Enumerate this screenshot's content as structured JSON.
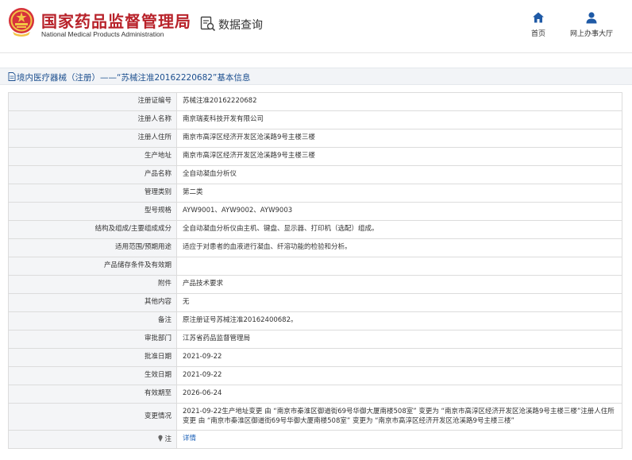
{
  "header": {
    "title": "国家药品监督管理局",
    "subtitle": "National Medical Products Administration",
    "query_label": "数据查询",
    "nav": {
      "home": "首页",
      "hall": "网上办事大厅"
    }
  },
  "breadcrumb": {
    "text": "境内医疗器械（注册）——“苏械注准20162220682”基本信息"
  },
  "record": {
    "rows": [
      {
        "label": "注册证编号",
        "value": "苏械注准20162220682"
      },
      {
        "label": "注册人名称",
        "value": "南京瑞麦科技开发有限公司"
      },
      {
        "label": "注册人住所",
        "value": "南京市高淳区经济开发区沧溪路9号主楼三楼"
      },
      {
        "label": "生产地址",
        "value": "南京市高淳区经济开发区沧溪路9号主楼三楼"
      },
      {
        "label": "产品名称",
        "value": "全自动凝血分析仪"
      },
      {
        "label": "管理类别",
        "value": "第二类"
      },
      {
        "label": "型号规格",
        "value": "AYW9001、AYW9002、AYW9003"
      },
      {
        "label": "结构及组成/主要组成成分",
        "value": "全自动凝血分析仪由主机、键盘、显示器、打印机（选配）组成。"
      },
      {
        "label": "适用范围/预期用途",
        "value": "适应于对患者的血液进行凝血、纤溶功能的检验和分析。"
      },
      {
        "label": "产品储存条件及有效期",
        "value": ""
      },
      {
        "label": "附件",
        "value": "产品技术要求"
      },
      {
        "label": "其他内容",
        "value": "无"
      },
      {
        "label": "备注",
        "value": "原注册证号苏械注准20162400682。"
      },
      {
        "label": "审批部门",
        "value": "江苏省药品监督管理局"
      },
      {
        "label": "批准日期",
        "value": "2021-09-22"
      },
      {
        "label": "生效日期",
        "value": "2021-09-22"
      },
      {
        "label": "有效期至",
        "value": "2026-06-24"
      }
    ],
    "change_label": "变更情况",
    "change_value": "2021-09-22生产地址变更 由 “南京市秦淮区御道街69号华御大厦南楼508室” 变更为 “南京市高淳区经济开发区沧溪路9号主楼三楼”注册人住所变更 由 “南京市秦淮区御道街69号华御大厦南楼508室” 变更为 “南京市高淳区经济开发区沧溪路9号主楼三楼”",
    "note_label": "注",
    "note_link": "详情"
  },
  "colors": {
    "brand_red": "#b8222a",
    "link_blue": "#1c61b8",
    "crumb_blue": "#1c4f8f",
    "label_bg": "#f4f5f7"
  },
  "icons": [
    "national-emblem-icon",
    "query-icon",
    "home-icon",
    "user-icon",
    "document-icon",
    "pin-icon"
  ]
}
